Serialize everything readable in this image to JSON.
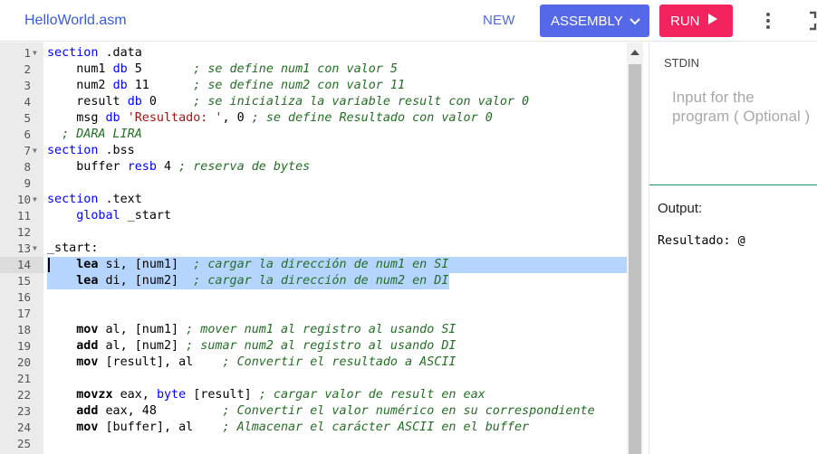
{
  "header": {
    "filename": "HelloWorld.asm",
    "new_label": "NEW",
    "language_label": "ASSEMBLY",
    "run_label": "RUN"
  },
  "icons": {
    "language": "chevron-down-icon",
    "run": "play-icon",
    "menu": "kebab-menu-icon",
    "expand": "expand-icon"
  },
  "colors": {
    "accent": "#5468e8",
    "run": "#f2235e",
    "filename": "#3a5be0",
    "selection": "#b5d5ff"
  },
  "editor": {
    "lines": [
      {
        "n": "1",
        "fold": true,
        "segs": [
          [
            "kw",
            "section"
          ],
          [
            "t",
            " .data"
          ]
        ]
      },
      {
        "n": "2",
        "fold": false,
        "segs": [
          [
            "t",
            "    num1 "
          ],
          [
            "kw",
            "db"
          ],
          [
            "t",
            " 5       "
          ],
          [
            "cm",
            "; se define num1 con valor 5"
          ]
        ]
      },
      {
        "n": "3",
        "fold": false,
        "segs": [
          [
            "t",
            "    num2 "
          ],
          [
            "kw",
            "db"
          ],
          [
            "t",
            " 11      "
          ],
          [
            "cm",
            "; se define num2 con valor 11"
          ]
        ]
      },
      {
        "n": "4",
        "fold": false,
        "segs": [
          [
            "t",
            "    result "
          ],
          [
            "kw",
            "db"
          ],
          [
            "t",
            " 0     "
          ],
          [
            "cm",
            "; se inicializa la variable result con valor 0"
          ]
        ]
      },
      {
        "n": "5",
        "fold": false,
        "segs": [
          [
            "t",
            "    msg "
          ],
          [
            "kw",
            "db"
          ],
          [
            "t",
            " "
          ],
          [
            "st",
            "'Resultado: '"
          ],
          [
            "t",
            ", 0 "
          ],
          [
            "cm",
            "; se define Resultado con valor 0"
          ]
        ]
      },
      {
        "n": "6",
        "fold": false,
        "segs": [
          [
            "cm",
            "  ; DARA LIRA"
          ]
        ]
      },
      {
        "n": "7",
        "fold": true,
        "segs": [
          [
            "kw",
            "section"
          ],
          [
            "t",
            " .bss"
          ]
        ]
      },
      {
        "n": "8",
        "fold": false,
        "segs": [
          [
            "t",
            "    buffer "
          ],
          [
            "kw",
            "resb"
          ],
          [
            "t",
            " 4 "
          ],
          [
            "cm",
            "; reserva de bytes"
          ]
        ]
      },
      {
        "n": "9",
        "fold": false,
        "segs": []
      },
      {
        "n": "10",
        "fold": true,
        "segs": [
          [
            "kw",
            "section"
          ],
          [
            "t",
            " .text"
          ]
        ]
      },
      {
        "n": "11",
        "fold": false,
        "segs": [
          [
            "t",
            "    "
          ],
          [
            "kw",
            "global"
          ],
          [
            "t",
            " _start"
          ]
        ]
      },
      {
        "n": "12",
        "fold": false,
        "segs": []
      },
      {
        "n": "13",
        "fold": true,
        "segs": [
          [
            "t",
            "_start:"
          ]
        ]
      },
      {
        "n": "14",
        "fold": false,
        "active": true,
        "sel": "full",
        "segs": [
          [
            "t",
            "    "
          ],
          [
            "b",
            "lea"
          ],
          [
            "t",
            " si, [num1]  "
          ],
          [
            "cm",
            "; cargar la dirección de num1 en SI"
          ]
        ]
      },
      {
        "n": "15",
        "fold": false,
        "sel": "partial",
        "segs": [
          [
            "t",
            "    "
          ],
          [
            "b",
            "lea"
          ],
          [
            "t",
            " di, [num2]  "
          ],
          [
            "cm",
            "; cargar la dirección de num2 en DI"
          ]
        ]
      },
      {
        "n": "16",
        "fold": false,
        "segs": []
      },
      {
        "n": "17",
        "fold": false,
        "segs": []
      },
      {
        "n": "18",
        "fold": false,
        "segs": [
          [
            "t",
            "    "
          ],
          [
            "b",
            "mov"
          ],
          [
            "t",
            " al, [num1] "
          ],
          [
            "cm",
            "; mover num1 al registro al usando SI"
          ]
        ]
      },
      {
        "n": "19",
        "fold": false,
        "segs": [
          [
            "t",
            "    "
          ],
          [
            "b",
            "add"
          ],
          [
            "t",
            " al, [num2] "
          ],
          [
            "cm",
            "; sumar num2 al registro al usando DI"
          ]
        ]
      },
      {
        "n": "20",
        "fold": false,
        "segs": [
          [
            "t",
            "    "
          ],
          [
            "b",
            "mov"
          ],
          [
            "t",
            " [result], al    "
          ],
          [
            "cm",
            "; Convertir el resultado a ASCII"
          ]
        ]
      },
      {
        "n": "21",
        "fold": false,
        "segs": []
      },
      {
        "n": "22",
        "fold": false,
        "segs": [
          [
            "t",
            "    "
          ],
          [
            "b",
            "movzx"
          ],
          [
            "t",
            " eax, "
          ],
          [
            "ty",
            "byte"
          ],
          [
            "t",
            " [result] "
          ],
          [
            "cm",
            "; cargar valor de result en eax"
          ]
        ]
      },
      {
        "n": "23",
        "fold": false,
        "segs": [
          [
            "t",
            "    "
          ],
          [
            "b",
            "add"
          ],
          [
            "t",
            " eax, 48         "
          ],
          [
            "cm",
            "; Convertir el valor numérico en su correspondiente"
          ]
        ]
      },
      {
        "n": "24",
        "fold": false,
        "segs": [
          [
            "t",
            "    "
          ],
          [
            "b",
            "mov"
          ],
          [
            "t",
            " [buffer], al    "
          ],
          [
            "cm",
            "; Almacenar el carácter ASCII en el buffer"
          ]
        ]
      },
      {
        "n": "25",
        "fold": false,
        "segs": []
      }
    ]
  },
  "stdin": {
    "label": "STDIN",
    "placeholder_line1": "Input for the",
    "placeholder_line2": "program ( Optional )"
  },
  "output": {
    "label": "Output:",
    "text": "Resultado: @"
  }
}
